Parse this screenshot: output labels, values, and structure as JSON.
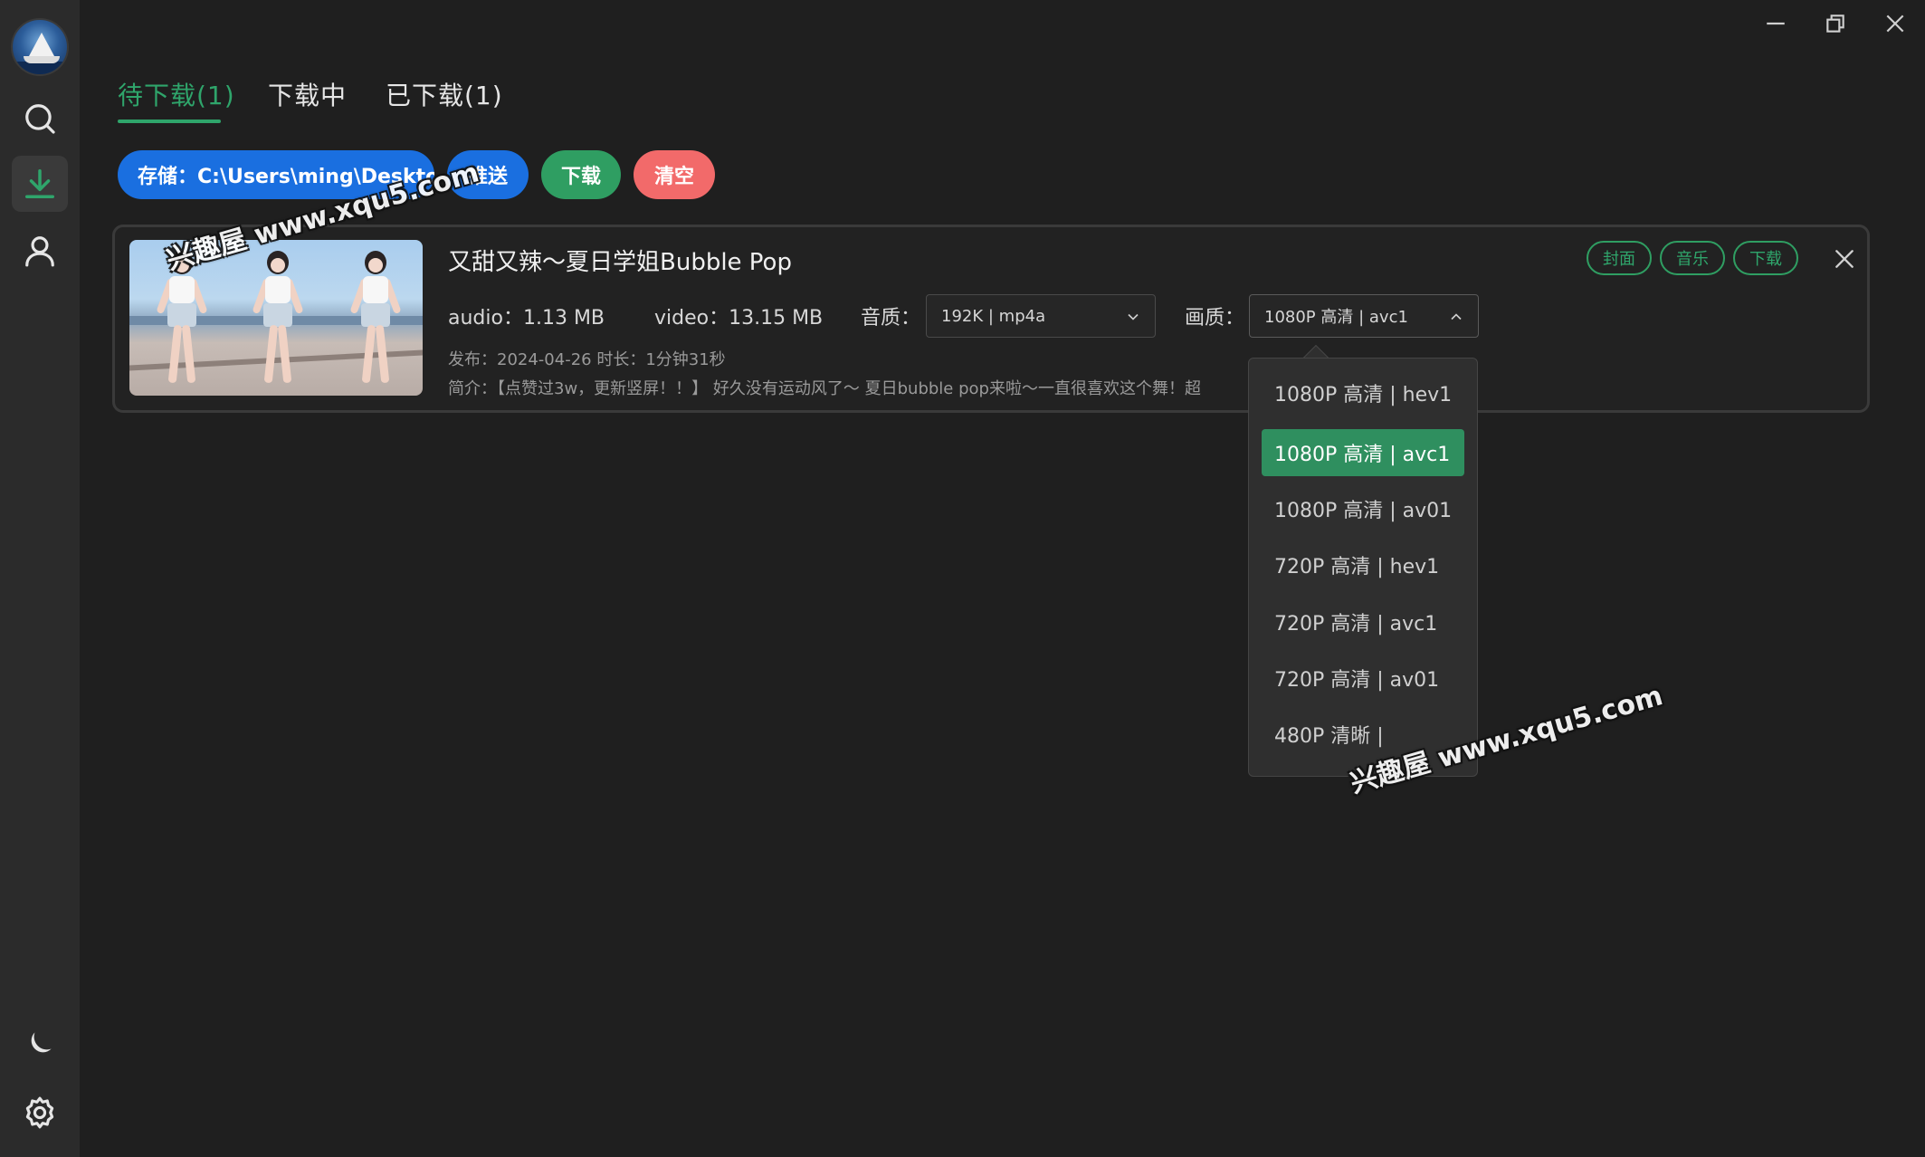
{
  "colors": {
    "accent_green": "#2fa56b",
    "primary_blue": "#1a6fe0",
    "danger_red": "#f26a6a",
    "background": "#1f1f1f",
    "sidebar": "#2b2b2b"
  },
  "sidebar": {
    "items": [
      {
        "icon": "search-icon"
      },
      {
        "icon": "download-icon",
        "active": true
      },
      {
        "icon": "user-icon"
      }
    ],
    "bottom": [
      {
        "icon": "moon-icon"
      },
      {
        "icon": "gear-icon"
      }
    ]
  },
  "tabs": [
    {
      "label": "待下载(1)",
      "active": true
    },
    {
      "label": "下载中"
    },
    {
      "label": "已下载(1)"
    }
  ],
  "actions": {
    "storage_label": "存储：C:\\Users\\ming\\Desktop",
    "push": "推送",
    "download": "下载",
    "clear": "清空"
  },
  "item": {
    "title": "又甜又辣～夏日学姐Bubble Pop",
    "audio_size": "audio：1.13 MB",
    "video_size": "video：13.15 MB",
    "audio_quality_label": "音质：",
    "audio_quality_value": "192K | mp4a",
    "video_quality_label": "画质：",
    "video_quality_value": "1080P 高清 | avc1",
    "publish": "发布：2024-04-26 时长：1分钟31秒",
    "description": "简介：【点赞过3w，更新竖屏！！】 好久没有运动风了～ 夏日bubble pop来啦～一直很喜欢这个舞！超",
    "tags": [
      "封面",
      "音乐",
      "下载"
    ]
  },
  "quality_options": [
    {
      "label": "1080P 高清 | hev1"
    },
    {
      "label": "1080P 高清 | avc1",
      "selected": true
    },
    {
      "label": "1080P 高清 | av01"
    },
    {
      "label": "720P 高清 | hev1"
    },
    {
      "label": "720P 高清 | avc1"
    },
    {
      "label": "720P 高清 | av01"
    },
    {
      "label": "480P 清晰 |"
    }
  ],
  "watermark": "兴趣屋 www.xqu5.com"
}
